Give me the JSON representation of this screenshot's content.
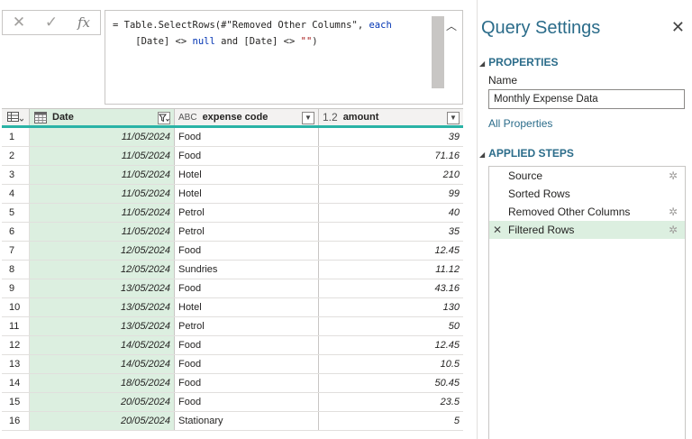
{
  "formula_bar": {
    "cancel_icon": "✕",
    "commit_icon": "✓",
    "fx_icon": "fx",
    "line1_pre": "= Table.SelectRows(#\"Removed Other Columns\", ",
    "line1_kw": "each",
    "line2_pre": "    [Date] <> ",
    "line2_null": "null",
    "line2_mid": " and [Date] <> ",
    "line2_str": "\"\"",
    "line2_post": ")"
  },
  "grid": {
    "columns": [
      {
        "name": "Date",
        "type_icon": "calendar-table-icon",
        "filter": "filtered"
      },
      {
        "name": "expense code",
        "type_icon": "ABC",
        "filter": "dropdown"
      },
      {
        "name": "amount",
        "type_icon": "1.2",
        "filter": "dropdown"
      }
    ],
    "rows": [
      {
        "n": "1",
        "date": "11/05/2024",
        "code": "Food",
        "amount": "39"
      },
      {
        "n": "2",
        "date": "11/05/2024",
        "code": "Food",
        "amount": "71.16"
      },
      {
        "n": "3",
        "date": "11/05/2024",
        "code": "Hotel",
        "amount": "210"
      },
      {
        "n": "4",
        "date": "11/05/2024",
        "code": "Hotel",
        "amount": "99"
      },
      {
        "n": "5",
        "date": "11/05/2024",
        "code": "Petrol",
        "amount": "40"
      },
      {
        "n": "6",
        "date": "11/05/2024",
        "code": "Petrol",
        "amount": "35"
      },
      {
        "n": "7",
        "date": "12/05/2024",
        "code": "Food",
        "amount": "12.45"
      },
      {
        "n": "8",
        "date": "12/05/2024",
        "code": "Sundries",
        "amount": "11.12"
      },
      {
        "n": "9",
        "date": "13/05/2024",
        "code": "Food",
        "amount": "43.16"
      },
      {
        "n": "10",
        "date": "13/05/2024",
        "code": "Hotel",
        "amount": "130"
      },
      {
        "n": "11",
        "date": "13/05/2024",
        "code": "Petrol",
        "amount": "50"
      },
      {
        "n": "12",
        "date": "14/05/2024",
        "code": "Food",
        "amount": "12.45"
      },
      {
        "n": "13",
        "date": "14/05/2024",
        "code": "Food",
        "amount": "10.5"
      },
      {
        "n": "14",
        "date": "18/05/2024",
        "code": "Food",
        "amount": "50.45"
      },
      {
        "n": "15",
        "date": "20/05/2024",
        "code": "Food",
        "amount": "23.5"
      },
      {
        "n": "16",
        "date": "20/05/2024",
        "code": "Stationary",
        "amount": "5"
      }
    ]
  },
  "query_settings": {
    "title": "Query Settings",
    "close_icon": "✕",
    "properties_heading": "PROPERTIES",
    "name_label": "Name",
    "name_value": "Monthly Expense Data",
    "all_properties_link": "All Properties",
    "applied_steps_heading": "APPLIED STEPS",
    "steps": [
      {
        "label": "Source",
        "gear": true,
        "active": false
      },
      {
        "label": "Sorted Rows",
        "gear": false,
        "active": false
      },
      {
        "label": "Removed Other Columns",
        "gear": true,
        "active": false
      },
      {
        "label": "Filtered Rows",
        "gear": true,
        "active": true
      }
    ]
  },
  "colors": {
    "accent": "#2b6c8a",
    "selected_column": "#dcefe0",
    "header_underline": "#2ab3a6"
  }
}
